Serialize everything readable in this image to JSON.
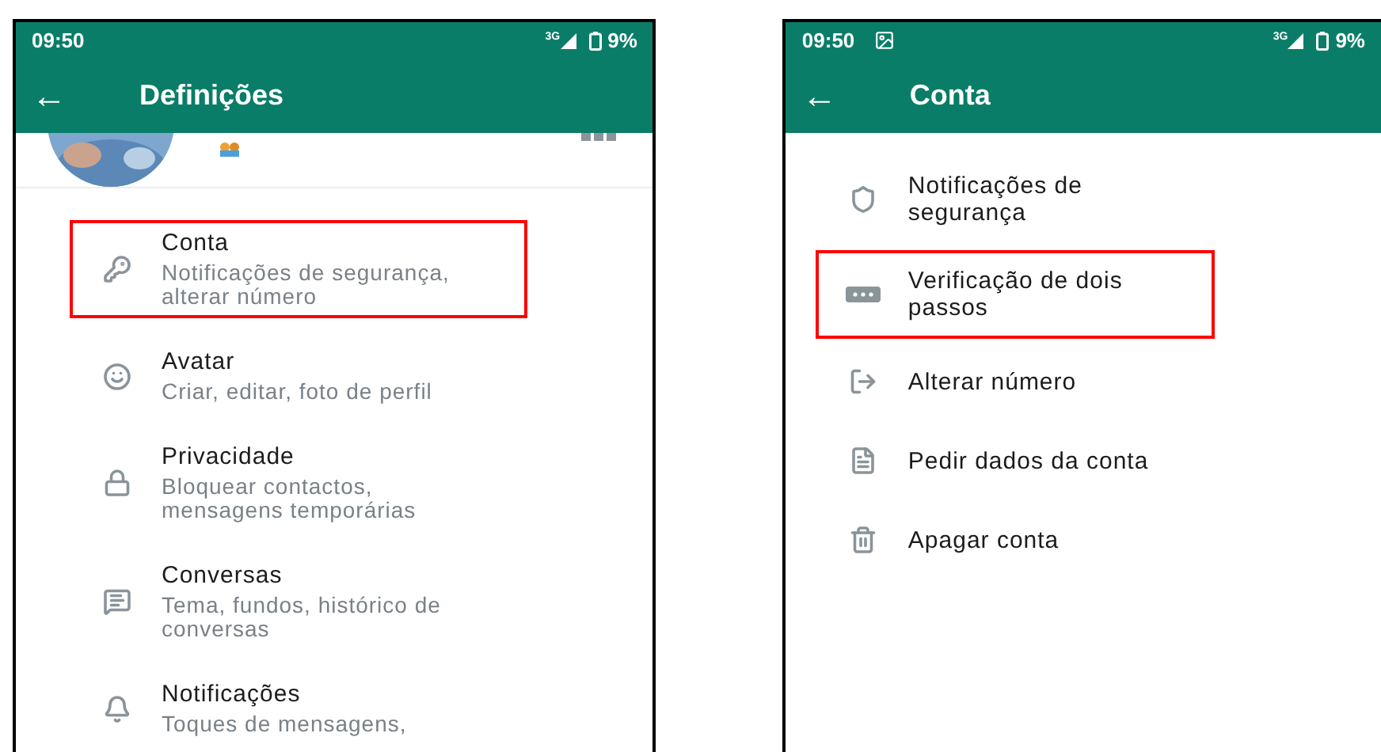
{
  "phones": [
    {
      "status_bar": {
        "time": "09:50",
        "network": "3G",
        "battery": "9%"
      },
      "toolbar": {
        "back": "←",
        "title": "Definições"
      },
      "items": [
        {
          "title": "Conta",
          "subtitle": "Notificações de segurança, alterar número",
          "highlighted": true
        },
        {
          "title": "Avatar",
          "subtitle": "Criar, editar, foto de perfil",
          "highlighted": false
        },
        {
          "title": "Privacidade",
          "subtitle": "Bloquear contactos, mensagens temporárias",
          "highlighted": false
        },
        {
          "title": "Conversas",
          "subtitle": "Tema, fundos, histórico de conversas",
          "highlighted": false
        },
        {
          "title": "Notificações",
          "subtitle": "Toques de mensagens,",
          "highlighted": false
        }
      ]
    },
    {
      "status_bar": {
        "time": "09:50",
        "network": "3G",
        "battery": "9%",
        "gallery_notification": true
      },
      "toolbar": {
        "back": "←",
        "title": "Conta"
      },
      "items": [
        {
          "title": "Notificações de segurança",
          "highlighted": false
        },
        {
          "title": "Verificação de dois passos",
          "highlighted": true
        },
        {
          "title": "Alterar número",
          "highlighted": false
        },
        {
          "title": "Pedir dados da conta",
          "highlighted": false
        },
        {
          "title": "Apagar conta",
          "highlighted": false
        }
      ]
    }
  ]
}
